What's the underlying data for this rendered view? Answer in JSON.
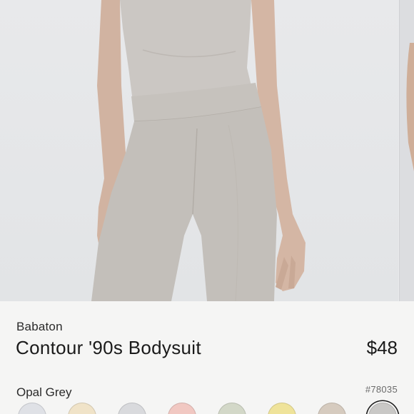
{
  "product": {
    "brand": "Babaton",
    "name": "Contour '90s Bodysuit",
    "price": "$48",
    "selected_color": "Opal Grey",
    "sku": "#78035"
  },
  "gallery": {
    "image": "model wearing grey bodysuit and leggings"
  },
  "swatches": [
    {
      "name": "light-grey",
      "color": "#dfe1e6"
    },
    {
      "name": "cream",
      "color": "#f0e3c8"
    },
    {
      "name": "silver-grey",
      "color": "#d9dadd"
    },
    {
      "name": "pink",
      "color": "#f1c8c2"
    },
    {
      "name": "sage",
      "color": "#d3d8c8"
    },
    {
      "name": "yellow",
      "color": "#efe39a"
    },
    {
      "name": "taupe",
      "color": "#d6cbbf"
    },
    {
      "name": "opal-grey",
      "color": "#c9c8c6",
      "selected": true
    }
  ]
}
